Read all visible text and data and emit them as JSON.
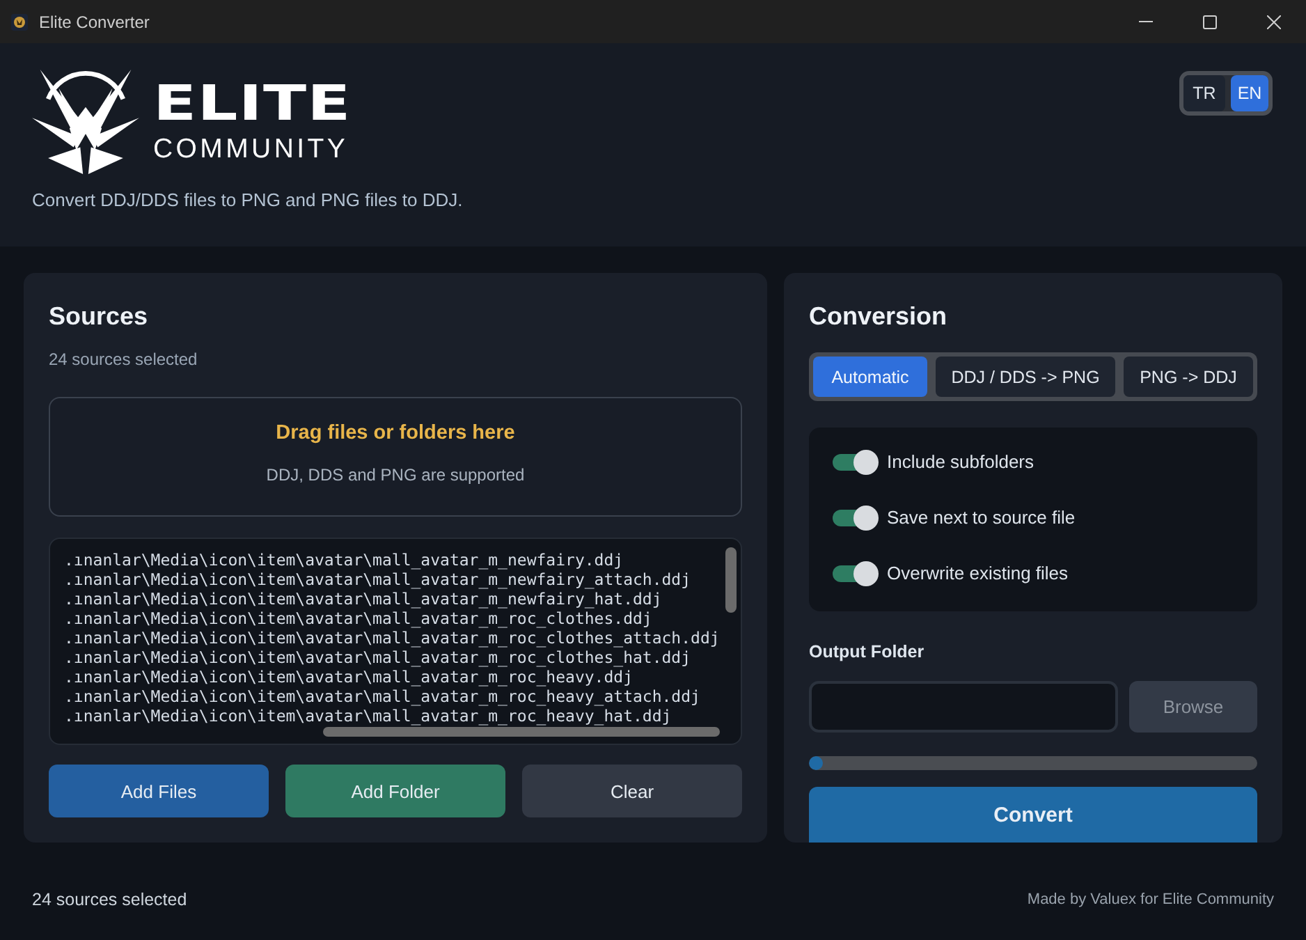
{
  "window": {
    "title": "Elite Converter"
  },
  "header": {
    "logo": {
      "line_1": "ELITE",
      "line_2": "COMMUNITY"
    },
    "subtitle": "Convert DDJ/DDS files to PNG and PNG files to DDJ.",
    "languages": [
      {
        "label": "TR",
        "selected": false
      },
      {
        "label": "EN",
        "selected": true
      }
    ]
  },
  "sources": {
    "title": "Sources",
    "count": "24 sources selected",
    "drop_zone": {
      "title": "Drag files or folders here",
      "hint": "DDJ, DDS and PNG are supported"
    },
    "files": [
      ".ınanlar\\Media\\icon\\item\\avatar\\mall_avatar_m_newfairy.ddj",
      ".ınanlar\\Media\\icon\\item\\avatar\\mall_avatar_m_newfairy_attach.ddj",
      ".ınanlar\\Media\\icon\\item\\avatar\\mall_avatar_m_newfairy_hat.ddj",
      ".ınanlar\\Media\\icon\\item\\avatar\\mall_avatar_m_roc_clothes.ddj",
      ".ınanlar\\Media\\icon\\item\\avatar\\mall_avatar_m_roc_clothes_attach.ddj",
      ".ınanlar\\Media\\icon\\item\\avatar\\mall_avatar_m_roc_clothes_hat.ddj",
      ".ınanlar\\Media\\icon\\item\\avatar\\mall_avatar_m_roc_heavy.ddj",
      ".ınanlar\\Media\\icon\\item\\avatar\\mall_avatar_m_roc_heavy_attach.ddj",
      ".ınanlar\\Media\\icon\\item\\avatar\\mall_avatar_m_roc_heavy_hat.ddj"
    ],
    "buttons": [
      {
        "label": "Add Files",
        "kind": "primary"
      },
      {
        "label": "Add Folder",
        "kind": "success"
      },
      {
        "label": "Clear",
        "kind": "neutral"
      }
    ]
  },
  "conversion": {
    "title": "Conversion",
    "modes": [
      {
        "label": "Automatic",
        "selected": true
      },
      {
        "label": "DDJ / DDS -> PNG",
        "selected": false
      },
      {
        "label": "PNG -> DDJ",
        "selected": false
      }
    ],
    "options": [
      {
        "label": "Include subfolders",
        "on": true
      },
      {
        "label": "Save next to source file",
        "on": true
      },
      {
        "label": "Overwrite existing files",
        "on": true
      }
    ],
    "output_folder": {
      "label": "Output Folder"
    },
    "browse": {
      "label": "Browse",
      "disabled": true
    },
    "progress": {
      "level": 0.03
    },
    "convert": {
      "label": "Convert"
    }
  },
  "status_bar": {
    "text": "24 sources selected",
    "credit": "Made by Valuex for Elite Community"
  }
}
